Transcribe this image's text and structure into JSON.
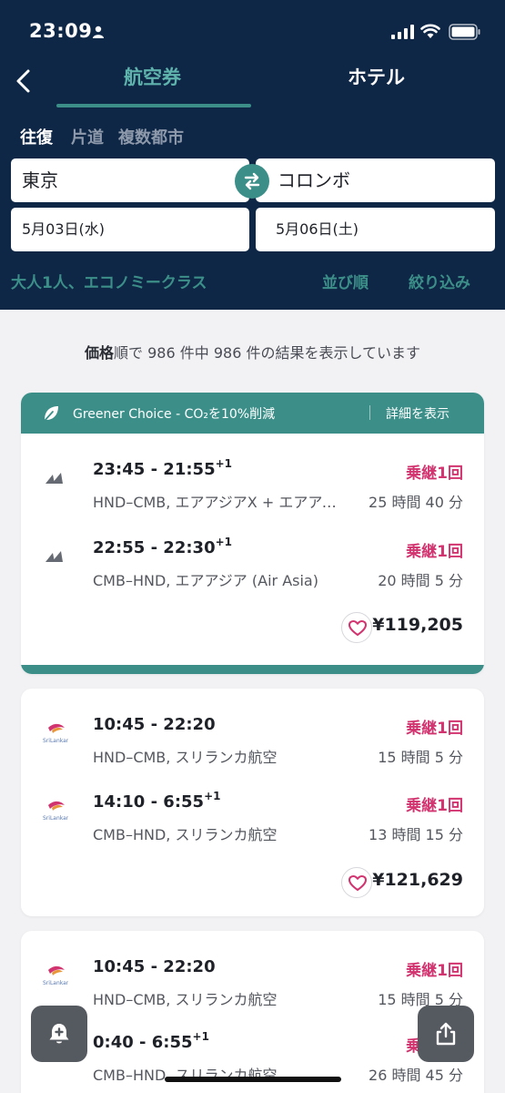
{
  "status_bar": {
    "time": "23:09"
  },
  "nav": {
    "tab_flights": "航空券",
    "tab_hotels": "ホテル"
  },
  "trip_types": {
    "round": "往復",
    "oneway": "片道",
    "multi": "複数都市"
  },
  "search": {
    "from": "東京",
    "to": "コロンボ",
    "depart_date": "5月03日(水)",
    "return_date": "5月06日(土)",
    "passengers": "大人1人、エコノミークラス",
    "sort": "並び順",
    "filter": "絞り込み"
  },
  "results_summary": {
    "bold": "価格",
    "rest": "順で 986 件中 986 件の結果を表示しています"
  },
  "greener": {
    "label": "Greener Choice - CO₂を10%削減",
    "detail": "詳細を表示"
  },
  "results": [
    {
      "legs": [
        {
          "airline_icon": "airasia-logo-icon",
          "times": "23:45 - 21:55",
          "plus": "+1",
          "stops": "乗継1回",
          "route": "HND–CMB, エアアジアX + エアアジア",
          "duration": "25 時間 40 分"
        },
        {
          "airline_icon": "airasia-logo-icon",
          "times": "22:55 - 22:30",
          "plus": "+1",
          "stops": "乗継1回",
          "route": "CMB–HND, エアアジア (Air Asia)",
          "duration": "20 時間 5 分"
        }
      ],
      "price": "¥119,205"
    },
    {
      "legs": [
        {
          "airline_icon": "srilankan-logo-icon",
          "times": "10:45 - 22:20",
          "plus": "",
          "stops": "乗継1回",
          "route": "HND–CMB, スリランカ航空",
          "duration": "15 時間 5 分"
        },
        {
          "airline_icon": "srilankan-logo-icon",
          "times": "14:10 - 6:55",
          "plus": "+1",
          "stops": "乗継1回",
          "route": "CMB–HND, スリランカ航空",
          "duration": "13 時間 15 分"
        }
      ],
      "price": "¥121,629"
    },
    {
      "legs": [
        {
          "airline_icon": "srilankan-logo-icon",
          "times": "10:45 - 22:20",
          "plus": "",
          "stops": "乗継1回",
          "route": "HND–CMB, スリランカ航空",
          "duration": "15 時間 5 分"
        },
        {
          "airline_icon": "srilankan-logo-icon",
          "times": "0:40 - 6:55",
          "plus": "+1",
          "stops": "乗継1回",
          "route": "CMB–HND, スリランカ航空",
          "duration": "26 時間 45 分"
        }
      ]
    }
  ],
  "colors": {
    "header_bg": "#0f2746",
    "accent_teal": "#3c8f89",
    "stops_pink": "#d1346f"
  }
}
